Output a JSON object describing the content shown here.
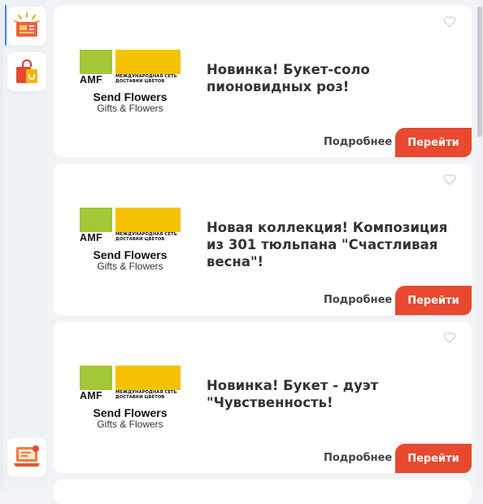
{
  "sidebar": {
    "items": [
      {
        "icon": "ticket-coupon-icon",
        "active": true
      },
      {
        "icon": "shopping-bag-icon",
        "active": false
      },
      {
        "icon": "laptop-chat-icon",
        "active": false
      }
    ],
    "accent": "#4d7cf6"
  },
  "logo": {
    "mark": "AMF",
    "tagline": "МЕЖДУНАРОДНАЯ СЕТЬ ДОСТАВКИ ЦВЕТОВ",
    "brand": "Send Flowers",
    "sub": "Gifts & Flowers",
    "colors": {
      "green": "#a4c639",
      "yellow": "#f5c200"
    }
  },
  "offers": [
    {
      "title": "Новинка! Букет-соло пионовидных роз!",
      "details_label": "Подробнее",
      "go_label": "Перейти"
    },
    {
      "title": "Новая коллекция! Композиция из 301 тюльпана \"Счастливая весна\"!",
      "details_label": "Подробнее",
      "go_label": "Перейти"
    },
    {
      "title": "Новинка! Букет - дуэт \"Чувственность!",
      "details_label": "Подробнее",
      "go_label": "Перейти"
    }
  ],
  "colors": {
    "go_button": "#e8492f",
    "background": "#f1f3f6"
  }
}
